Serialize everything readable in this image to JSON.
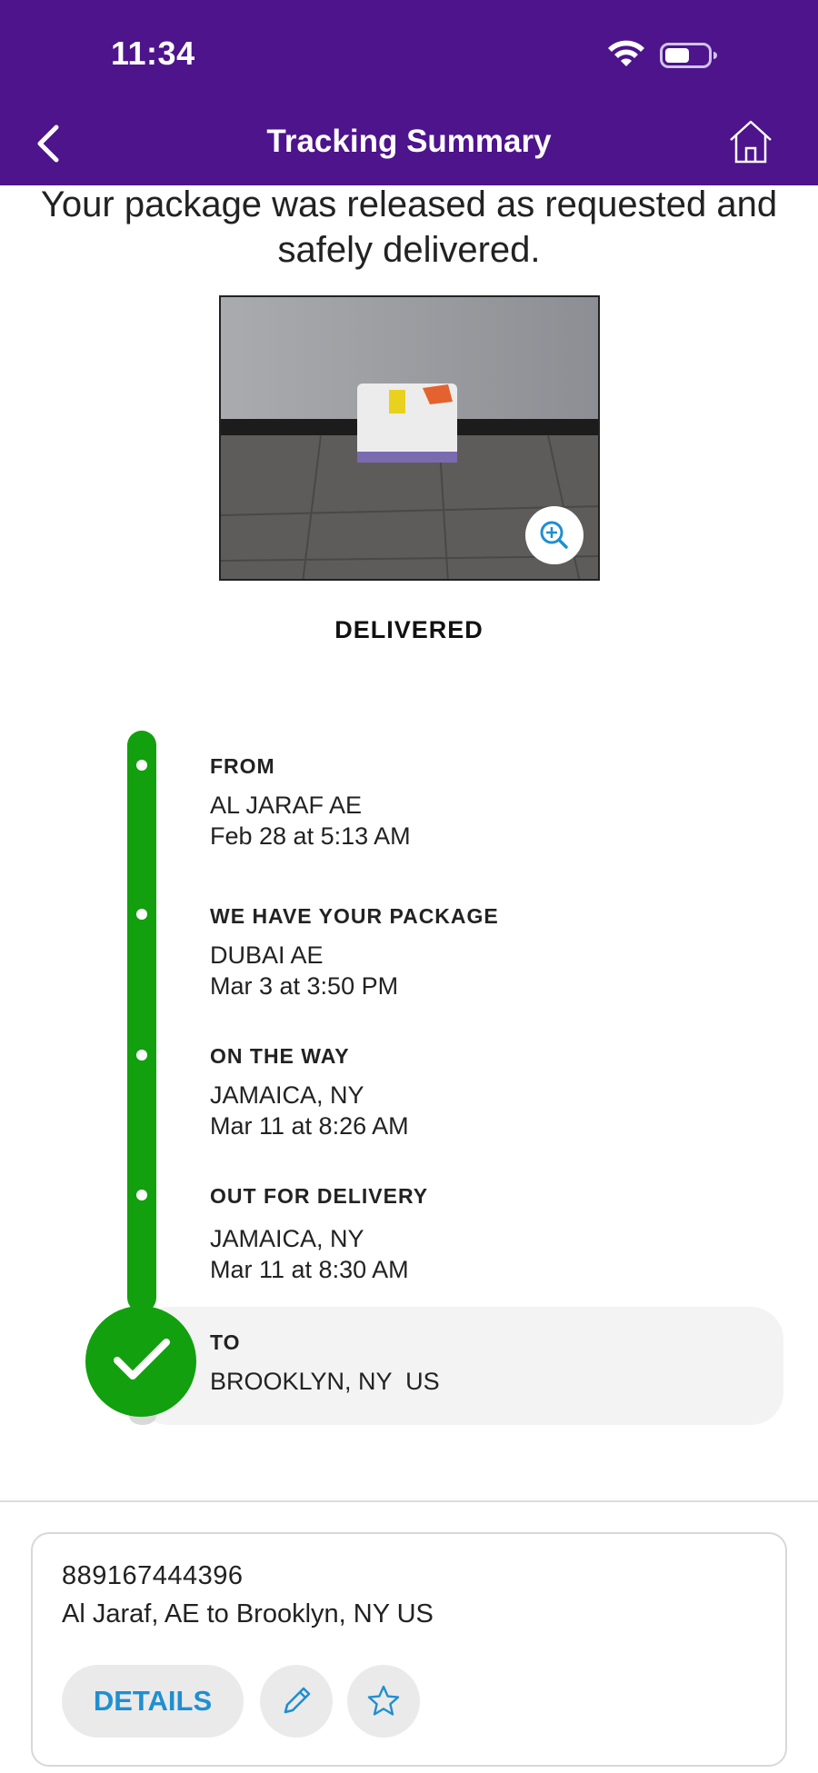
{
  "status_bar": {
    "time": "11:34"
  },
  "nav": {
    "title": "Tracking Summary",
    "back_icon": "chevron-left-icon",
    "home_icon": "home-icon"
  },
  "message": "Your package was released as requested and safely delivered.",
  "photo": {
    "zoom_icon": "zoom-in-icon"
  },
  "status": "DELIVERED",
  "colors": {
    "header": "#4d148c",
    "progress": "#12a00e",
    "accent": "#1f8fd1"
  },
  "timeline": {
    "from": {
      "title": "FROM",
      "location": "AL JARAF AE",
      "time": "Feb 28 at 5:13 AM"
    },
    "picked": {
      "title": "WE HAVE YOUR PACKAGE",
      "location": "DUBAI AE",
      "time": "Mar 3 at 3:50 PM"
    },
    "on_way": {
      "title": "ON THE WAY",
      "location": "JAMAICA, NY",
      "time": "Mar 11 at 8:26 AM"
    },
    "out": {
      "title": "OUT FOR DELIVERY",
      "location": "JAMAICA, NY",
      "time": "Mar 11 at 8:30 AM"
    },
    "to": {
      "title": "TO",
      "location": "BROOKLYN, NY  US"
    }
  },
  "card": {
    "tracking_number": "889167444396",
    "route": "Al Jaraf, AE to Brooklyn, NY US",
    "details_label": "DETAILS",
    "edit_icon": "pencil-icon",
    "watch_icon": "star-icon"
  }
}
